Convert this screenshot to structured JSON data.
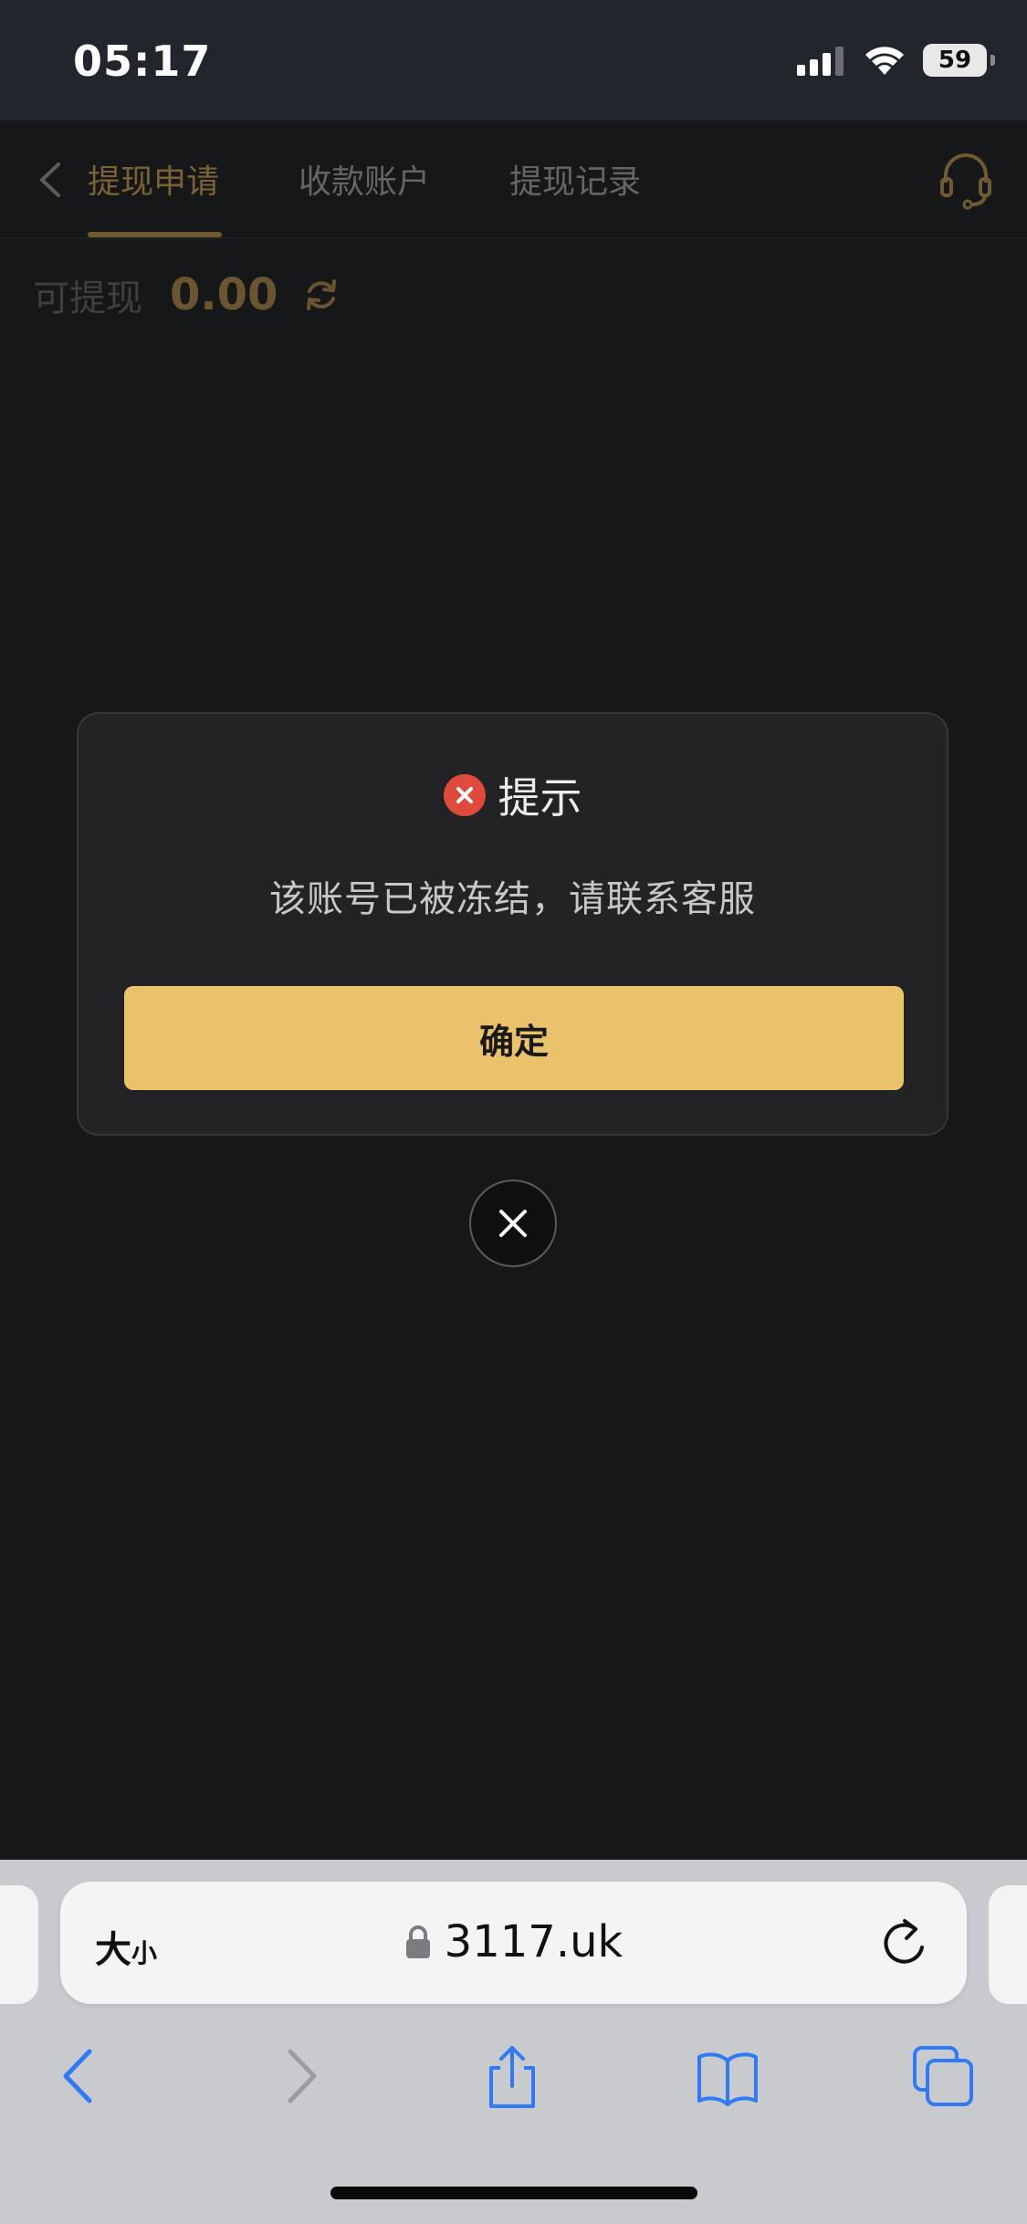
{
  "status_bar": {
    "time": "05:17",
    "battery": "59"
  },
  "header": {
    "tabs": [
      {
        "label": "提现申请",
        "active": true
      },
      {
        "label": "收款账户",
        "active": false
      },
      {
        "label": "提现记录",
        "active": false
      }
    ]
  },
  "balance": {
    "label": "可提现",
    "value": "0.00"
  },
  "dialog": {
    "title": "提示",
    "message": "该账号已被冻结，请联系客服",
    "confirm_label": "确定"
  },
  "browser": {
    "text_size_label_big": "大",
    "text_size_label_small": "小",
    "url": "3117.uk"
  },
  "colors": {
    "accent": "#e9c26b",
    "error": "#e04a3c",
    "safari_blue": "#2f7bf6"
  }
}
